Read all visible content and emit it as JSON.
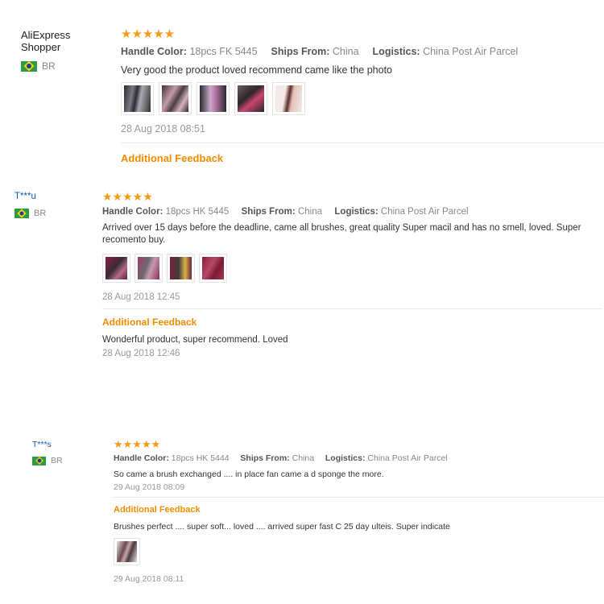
{
  "labels": {
    "handle_color": "Handle Color:",
    "ships_from": "Ships From:",
    "logistics": "Logistics:",
    "additional_feedback": "Additional Feedback"
  },
  "reviews": [
    {
      "user": "AliExpress Shopper",
      "country": "BR",
      "stars": "★★★★★",
      "rating": 5,
      "handle_color": "18pcs FK 5445",
      "ships_from": "China",
      "logistics": "China Post Air Parcel",
      "text": "Very good the product loved recommend came like the photo",
      "date": "28 Aug 2018 08:51",
      "photo_count": 5
    },
    {
      "user": "T***u",
      "country": "BR",
      "stars": "★★★★★",
      "rating": 5,
      "handle_color": "18pcs HK 5445",
      "ships_from": "China",
      "logistics": "China Post Air Parcel",
      "text": "Arrived over 15 days before the deadline, came all brushes, great quality Super macil and has no smell, loved. Super recomento buy.",
      "date": "28 Aug 2018 12:45",
      "photo_count": 4,
      "additional_text": "Wonderful product, super recommend. Loved",
      "additional_date": "28 Aug 2018 12:46"
    },
    {
      "user": "T***s",
      "country": "BR",
      "stars": "★★★★★",
      "rating": 5,
      "handle_color": "18pcs HK 5444",
      "ships_from": "China",
      "logistics": "China Post Air Parcel",
      "text": "So came a brush exchanged .... in place fan came a d sponge the more.",
      "date": "29 Aug 2018 08:09",
      "additional_text": "Brushes perfect .... super soft... loved .... arrived super fast C 25 day ulteis. Super indicate",
      "additional_photo_count": 1,
      "additional_date": "29 Aug 2018 08:11"
    }
  ],
  "colors": {
    "star": "#f79b16",
    "additional_feedback": "#f28c00",
    "username_link": "#0e5bb5",
    "flag_green": "#2a9d3e",
    "flag_yellow": "#f2d21b",
    "flag_blue": "#1d3f91"
  }
}
